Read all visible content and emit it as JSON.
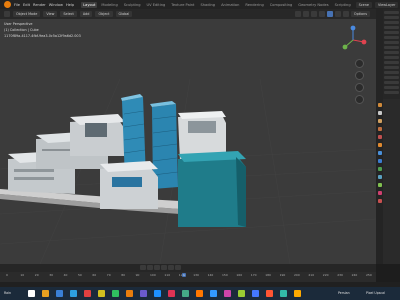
{
  "menubar": {
    "items": [
      "File",
      "Edit",
      "Render",
      "Window",
      "Help"
    ],
    "workspaces": [
      "Layout",
      "Modeling",
      "Sculpting",
      "UV Editing",
      "Texture Paint",
      "Shading",
      "Animation",
      "Rendering",
      "Compositing",
      "Geometry Nodes",
      "Scripting"
    ],
    "active_workspace": "Layout",
    "scene": "Scene",
    "view_layer": "ViewLayer"
  },
  "viewport_header": {
    "mode": "Object Mode",
    "view": "View",
    "select": "Select",
    "add": "Add",
    "object": "Object",
    "transform": "Global",
    "options": "Options"
  },
  "viewport": {
    "info_line": "User Perspective",
    "collection_line": "(1) Collection | Cube",
    "id_text": "1170f89a-4117-4fbf-9ea3-0c5a12f9a6d2.003"
  },
  "timeline": {
    "ticks": [
      "0",
      "10",
      "20",
      "30",
      "40",
      "50",
      "60",
      "70",
      "80",
      "90",
      "100",
      "110",
      "120",
      "130",
      "140",
      "150",
      "160",
      "170",
      "180",
      "190",
      "200",
      "210",
      "220",
      "230",
      "240",
      "250"
    ],
    "current_frame": "1"
  },
  "taskbar": {
    "left_item": "Rain",
    "right_item_1": "Persian",
    "right_item_2": "Pixel Upscal",
    "icon_colors": [
      "#ffffff",
      "#e8a020",
      "#3a7fd5",
      "#2ea0e0",
      "#e04040",
      "#d0c020",
      "#30c060",
      "#e87d0d",
      "#6a5acd",
      "#1e90ff",
      "#dd3355",
      "#44aa88",
      "#ff7700",
      "#3399ff",
      "#cc44aa",
      "#99cc33",
      "#4477ff",
      "#ff5533",
      "#33bbaa",
      "#ffaa00"
    ]
  }
}
